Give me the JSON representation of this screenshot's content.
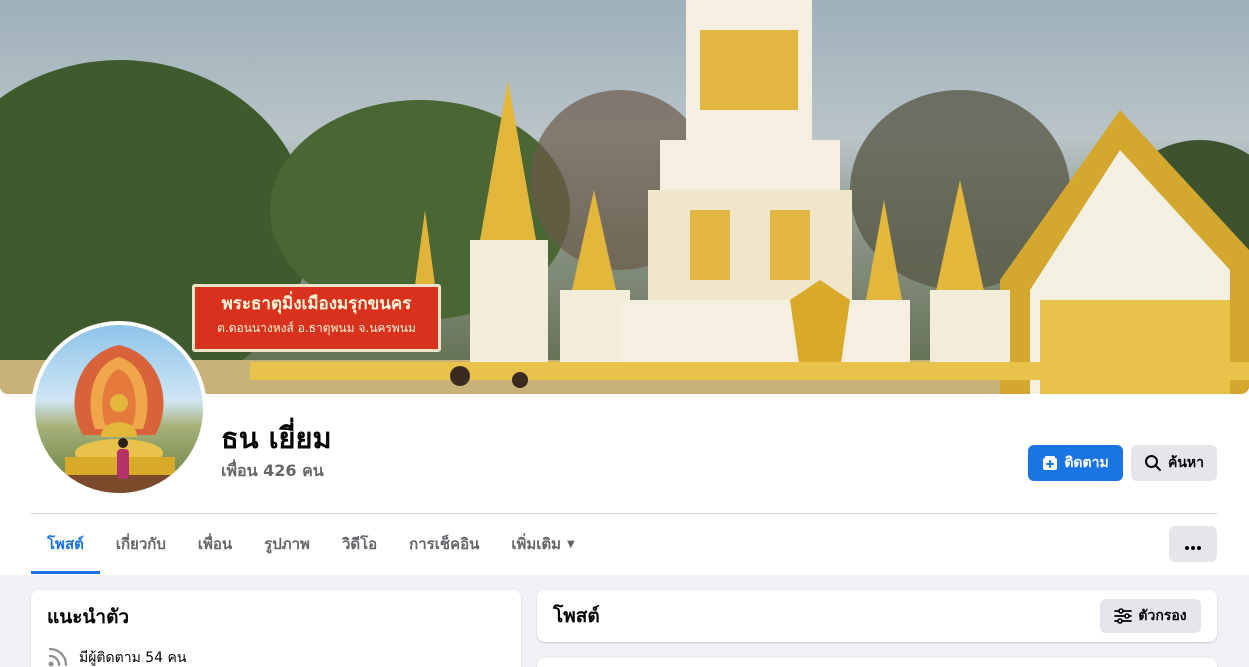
{
  "profile": {
    "name": "ธน เยี่ยม",
    "friends_count": "เพื่อน 426 คน"
  },
  "cover": {
    "sign_line1": "พระธาตุมิ่งเมืองมรุกขนคร",
    "sign_line2": "ต.ดอนนางหงส์ อ.ธาตุพนม จ.นครพนม"
  },
  "actions": {
    "follow_label": "ติดตาม",
    "search_label": "ค้นหา"
  },
  "tabs": [
    {
      "label": "โพสต์",
      "active": true
    },
    {
      "label": "เกี่ยวกับ",
      "active": false
    },
    {
      "label": "เพื่อน",
      "active": false
    },
    {
      "label": "รูปภาพ",
      "active": false
    },
    {
      "label": "วิดีโอ",
      "active": false
    },
    {
      "label": "การเช็คอิน",
      "active": false
    },
    {
      "label": "เพิ่มเติม",
      "active": false
    }
  ],
  "intro": {
    "title": "แนะนำตัว",
    "followers": "มีผู้ติดตาม 54 คน"
  },
  "posts": {
    "title": "โพสต์",
    "filter_label": "ตัวกรอง"
  },
  "colors": {
    "accent": "#1b74e4",
    "page_bg": "#f0f2f5",
    "secondary_text": "#65676b",
    "button_gray": "#e4e6eb"
  }
}
